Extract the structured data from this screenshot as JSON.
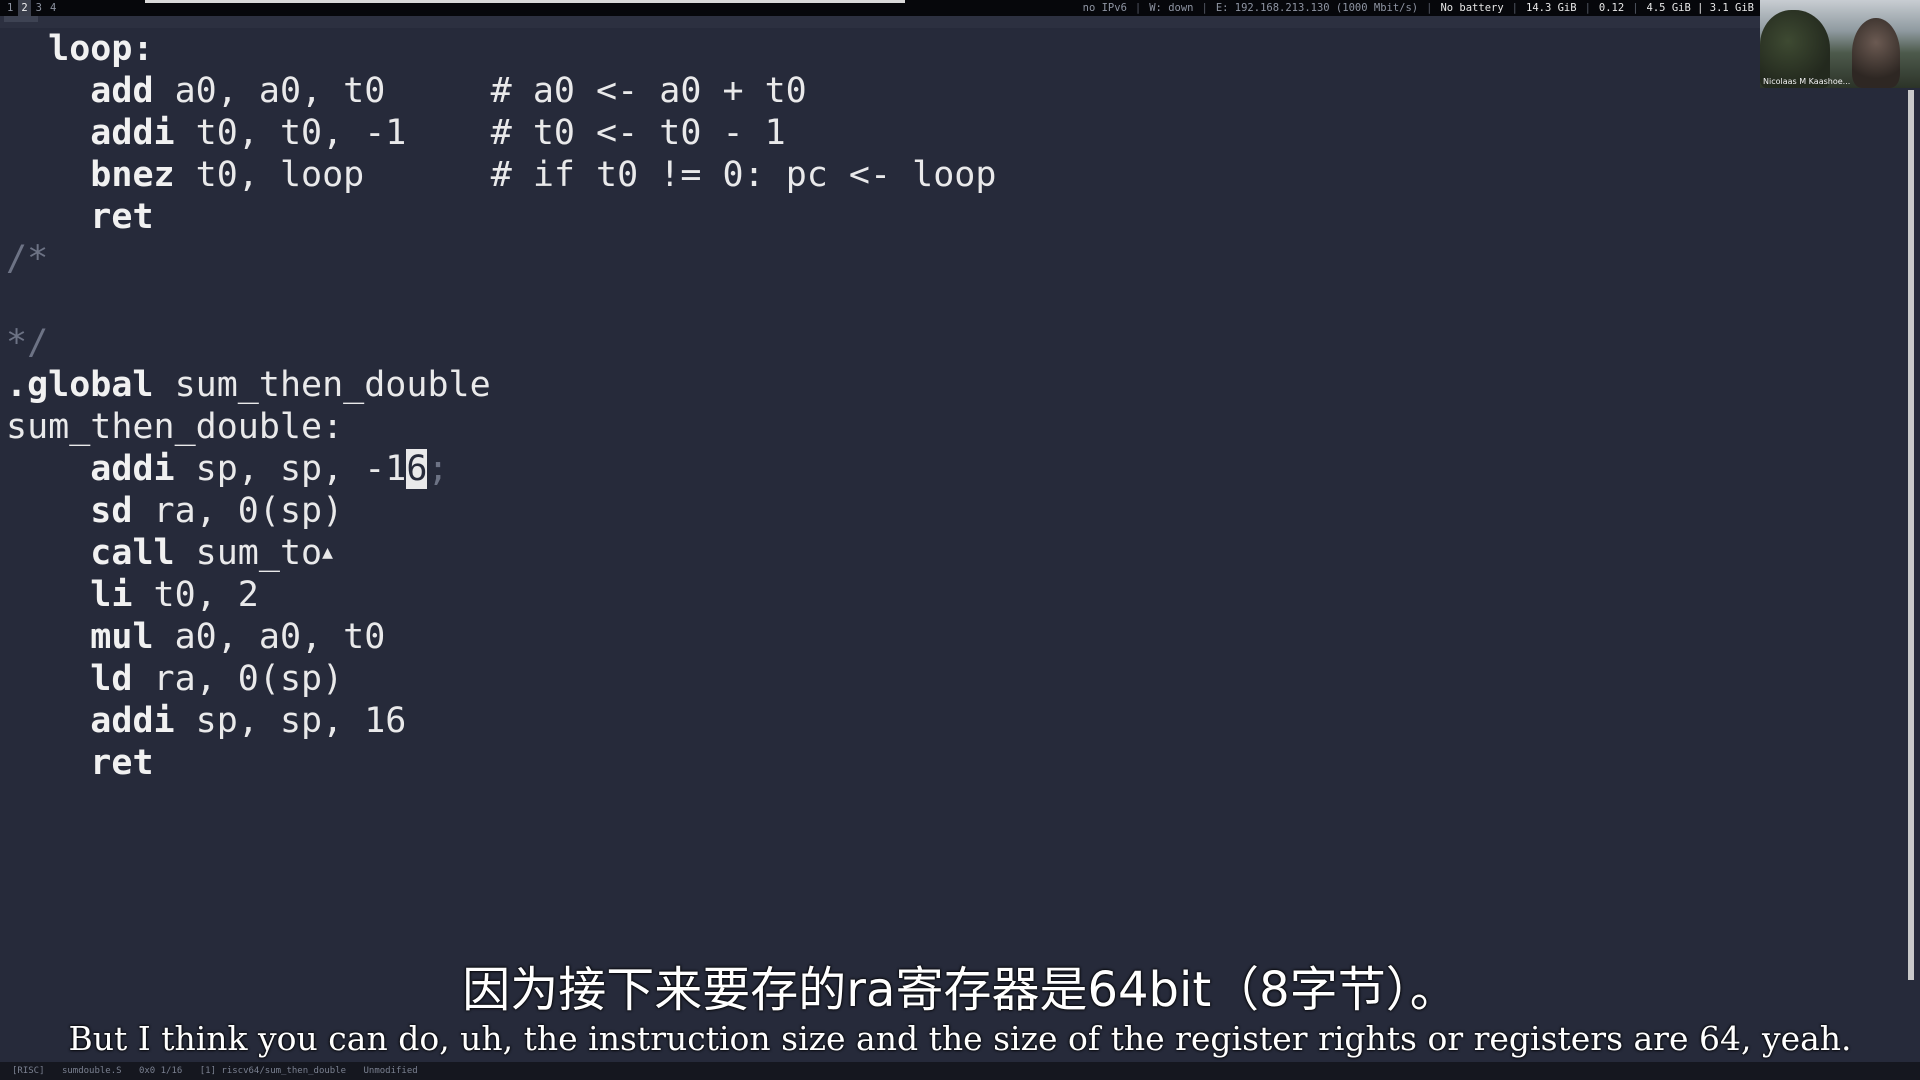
{
  "topbar": {
    "workspaces": [
      "1",
      "2",
      "3",
      "4"
    ],
    "active_workspace": "2",
    "status": {
      "ipv6": "no IPv6",
      "wifi": "W: down",
      "ethernet": "E: 192.168.213.130 (1000 Mbit/s)",
      "battery": "No battery",
      "disk": "14.3 GiB",
      "load": "0.12",
      "memory": "4.5 GiB | 3.1 GiB"
    }
  },
  "webcam": {
    "name": "Nicolaas M Kaashoe..."
  },
  "editor": {
    "lines": {
      "l1": "loop:",
      "l2_kw": "add",
      "l2_args": " a0, a0, t0",
      "l2_cm": "# a0 <- a0 + t0",
      "l3_kw": "addi",
      "l3_args": " t0, t0, -1",
      "l3_cm": "# t0 <- t0 - 1",
      "l4_kw": "bnez",
      "l4_args": " t0, loop",
      "l4_cm": "# if t0 != 0: pc <- loop",
      "l5_kw": "ret",
      "l6": "/*",
      "l8": "*/",
      "l9_kw": ".global",
      "l9_args": " sum_then_double",
      "l10": "sum_then_double:",
      "l11_kw": "addi",
      "l11_args": " sp, sp, -1",
      "l11_cursor": "6",
      "l11_after": ";",
      "l12_kw": "sd",
      "l12_args": " ra, 0(sp)",
      "l13_kw": "call",
      "l13_args": " sum_to",
      "l14_kw": "li",
      "l14_args": " t0, 2",
      "l15_kw": "mul",
      "l15_args": " a0, a0, t0",
      "l16_kw": "ld",
      "l16_args": " ra, 0(sp)",
      "l17_kw": "addi",
      "l17_args": " sp, sp, 16",
      "l18_kw": "ret"
    }
  },
  "subtitles": {
    "chinese": "因为接下来要存的ra寄存器是64bit（8字节）。",
    "english": "But I think you can do, uh, the instruction size and the size of the register rights or registers are 64, yeah."
  },
  "bottombar": {
    "items": [
      "[RISC]",
      "sumdouble.S",
      "0x0 1/16",
      "[1] riscv64/sum_then_double",
      "Unmodified"
    ]
  }
}
